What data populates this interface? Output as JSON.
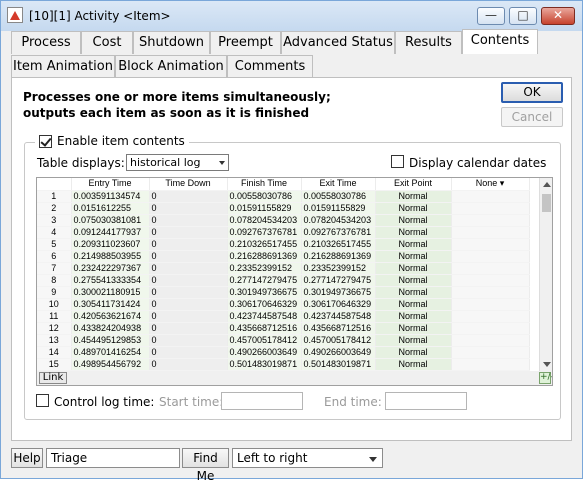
{
  "window": {
    "title": "[10][1] Activity <Item>"
  },
  "tabs_row1": [
    {
      "label": "Process"
    },
    {
      "label": "Cost"
    },
    {
      "label": "Shutdown"
    },
    {
      "label": "Preempt"
    },
    {
      "label": "Advanced Status"
    },
    {
      "label": "Results"
    },
    {
      "label": "Contents"
    }
  ],
  "tabs_row2": [
    {
      "label": "Item Animation"
    },
    {
      "label": "Block Animation"
    },
    {
      "label": "Comments"
    }
  ],
  "active_tab": "Contents",
  "description": "Processes one or more items simultaneously; outputs each item as soon as it is finished",
  "buttons": {
    "ok": "OK",
    "cancel": "Cancel"
  },
  "contents": {
    "enable_label": "Enable item contents",
    "enable_checked": true,
    "table_displays_label": "Table displays:",
    "table_displays_value": "historical log",
    "calendar_label": "Display calendar dates",
    "calendar_checked": false
  },
  "table": {
    "columns": [
      "Entry Time",
      "Time Down",
      "Finish Time",
      "Exit Time",
      "Exit Point",
      "None"
    ],
    "rows": [
      [
        "1",
        "0.003591134574",
        "0",
        "0.00558030786",
        "0.00558030786",
        "Normal",
        ""
      ],
      [
        "2",
        "0.0151612255",
        "0",
        "0.01591155829",
        "0.01591155829",
        "Normal",
        ""
      ],
      [
        "3",
        "0.075030381081",
        "0",
        "0.078204534203",
        "0.078204534203",
        "Normal",
        ""
      ],
      [
        "4",
        "0.091244177937",
        "0",
        "0.092767376781",
        "0.092767376781",
        "Normal",
        ""
      ],
      [
        "5",
        "0.209311023607",
        "0",
        "0.210326517455",
        "0.210326517455",
        "Normal",
        ""
      ],
      [
        "6",
        "0.214988503955",
        "0",
        "0.216288691369",
        "0.216288691369",
        "Normal",
        ""
      ],
      [
        "7",
        "0.232422297367",
        "0",
        "0.23352399152",
        "0.23352399152",
        "Normal",
        ""
      ],
      [
        "8",
        "0.275541333354",
        "0",
        "0.277147279475",
        "0.277147279475",
        "Normal",
        ""
      ],
      [
        "9",
        "0.300021180915",
        "0",
        "0.301949736675",
        "0.301949736675",
        "Normal",
        ""
      ],
      [
        "10",
        "0.305411731424",
        "0",
        "0.306170646329",
        "0.306170646329",
        "Normal",
        ""
      ],
      [
        "11",
        "0.420563621674",
        "0",
        "0.423744587548",
        "0.423744587548",
        "Normal",
        ""
      ],
      [
        "12",
        "0.433824204938",
        "0",
        "0.435668712516",
        "0.435668712516",
        "Normal",
        ""
      ],
      [
        "13",
        "0.454495129853",
        "0",
        "0.457005178412",
        "0.457005178412",
        "Normal",
        ""
      ],
      [
        "14",
        "0.489701416254",
        "0",
        "0.490266003649",
        "0.490266003649",
        "Normal",
        ""
      ],
      [
        "15",
        "0.498954456792",
        "0",
        "0.501483019871",
        "0.501483019871",
        "Normal",
        ""
      ]
    ],
    "link_label": "Link",
    "resize_glyph": "+/-"
  },
  "log": {
    "control_label": "Control log time:",
    "control_checked": false,
    "start_label": "Start time:",
    "start_value": "",
    "end_label": "End time:",
    "end_value": ""
  },
  "footer": {
    "help": "Help",
    "search_value": "Triage",
    "find_me": "Find Me",
    "direction": "Left to right"
  }
}
